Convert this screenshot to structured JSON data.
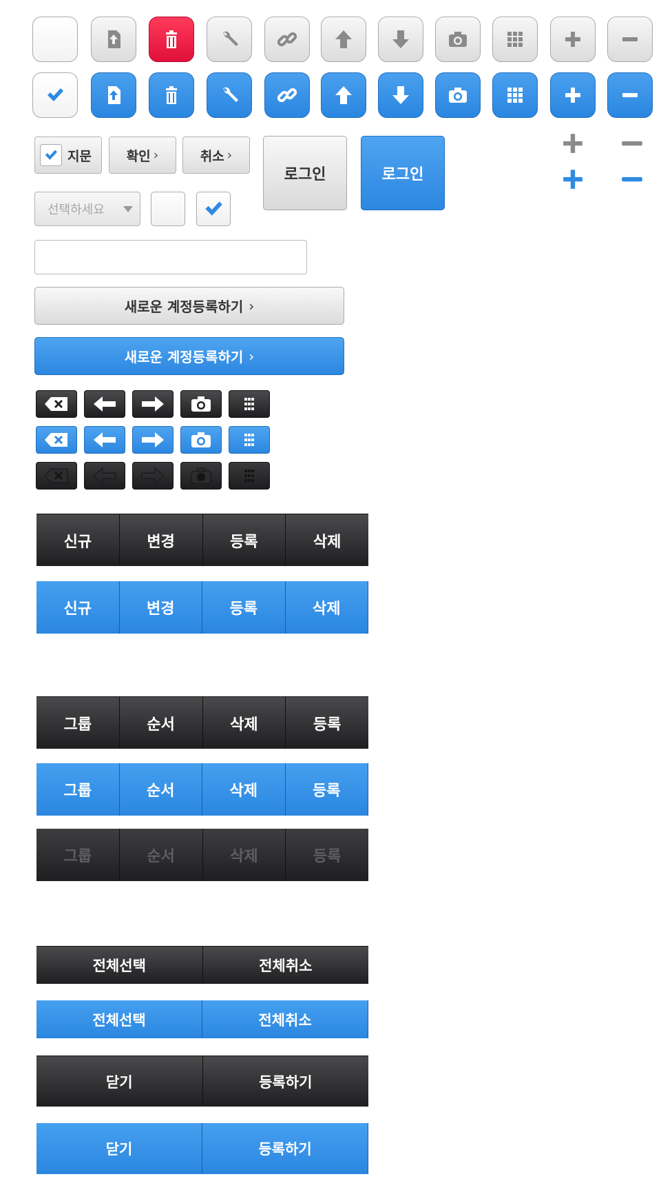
{
  "colors": {
    "blue": "#2e8ae2",
    "red": "#ee1840",
    "dark": "#2b2b2d",
    "gray": "#dcdcdc",
    "disabled_text": "#5e5e60"
  },
  "icon_row_1": [
    "blank",
    "upload-file-icon",
    "trash-icon",
    "wrench-icon",
    "link-icon",
    "arrow-up-icon",
    "arrow-down-icon",
    "camera-icon",
    "grid-icon",
    "plus-icon",
    "minus-icon"
  ],
  "icon_row_2": [
    "check-icon",
    "upload-file-icon",
    "trash-icon",
    "wrench-icon",
    "link-icon",
    "arrow-up-icon",
    "arrow-down-icon",
    "camera-icon",
    "grid-icon",
    "plus-icon",
    "minus-icon"
  ],
  "buttons": {
    "fingerprint": "지문",
    "confirm": "확인",
    "cancel": "취소",
    "chevron": "›",
    "login_gray": "로그인",
    "login_blue": "로그인",
    "select_placeholder": "선택하세요",
    "register_gray": "새로운 계정등록하기",
    "register_blue": "새로운 계정등록하기"
  },
  "tabs_1": [
    "신규",
    "변경",
    "등록",
    "삭제"
  ],
  "tabs_2": [
    "그룹",
    "순서",
    "삭제",
    "등록"
  ],
  "select_all_bar": [
    "전체선택",
    "전체취소"
  ],
  "close_bar": [
    "닫기",
    "등록하기"
  ]
}
